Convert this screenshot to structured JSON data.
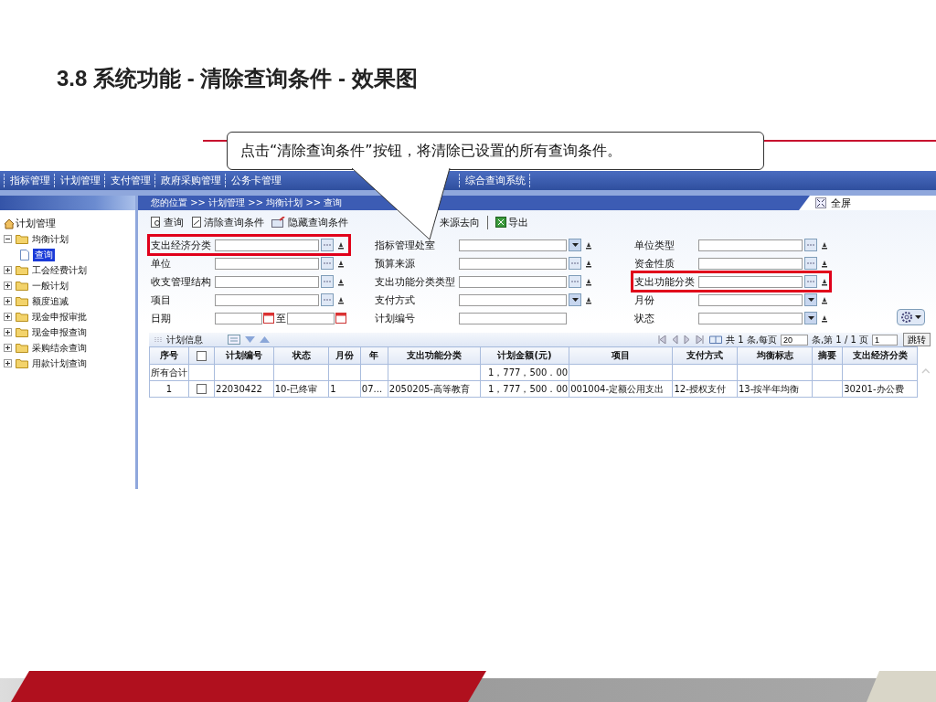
{
  "slide_title": "3.8  系统功能 - 清除查询条件 - 效果图",
  "callout": "点击“清除查询条件”按钮，将清除已设置的所有查询条件。",
  "nav_tabs": [
    {
      "label": "指标管理"
    },
    {
      "label": "计划管理"
    },
    {
      "label": "支付管理"
    },
    {
      "label": "政府采购管理"
    },
    {
      "label": "公务卡管理"
    },
    {
      "label": "综合查询系统"
    }
  ],
  "breadcrumb": "您的位置 >> 计划管理 >> 均衡计划 >> 查询",
  "fullscreen": "全屏",
  "sidebar": {
    "root": "计划管理",
    "items": [
      {
        "label": "均衡计划",
        "expanded": true,
        "children": [
          {
            "label": "查询",
            "selected": true
          }
        ]
      },
      {
        "label": "工会经费计划",
        "expanded": false
      },
      {
        "label": "一般计划",
        "expanded": false
      },
      {
        "label": "额度追减",
        "expanded": false
      },
      {
        "label": "现金申报审批",
        "expanded": false
      },
      {
        "label": "现金申报查询",
        "expanded": false
      },
      {
        "label": "采购结余查询",
        "expanded": false
      },
      {
        "label": "用款计划查询",
        "expanded": false
      }
    ]
  },
  "toolbar": [
    {
      "label": "查询"
    },
    {
      "label": "清除查询条件"
    },
    {
      "label": "隐藏查询条件"
    },
    {
      "label": "来源去向"
    },
    {
      "label": "导出"
    }
  ],
  "form_columns": [
    [
      {
        "label": "支出经济分类",
        "kind": "picker",
        "highlighted": true
      },
      {
        "label": "单位",
        "kind": "picker",
        "highlighted": false
      },
      {
        "label": "收支管理结构",
        "kind": "picker",
        "highlighted": false
      },
      {
        "label": "项目",
        "kind": "picker",
        "highlighted": false
      },
      {
        "label": "日期",
        "kind": "date",
        "separator": "至",
        "highlighted": false
      }
    ],
    [
      {
        "label": "指标管理处室",
        "kind": "select",
        "highlighted": false
      },
      {
        "label": "预算来源",
        "kind": "picker",
        "highlighted": false
      },
      {
        "label": "支出功能分类类型",
        "kind": "picker",
        "highlighted": false
      },
      {
        "label": "支付方式",
        "kind": "select",
        "highlighted": false
      },
      {
        "label": "计划编号",
        "kind": "text",
        "highlighted": false
      }
    ],
    [
      {
        "label": "单位类型",
        "kind": "picker",
        "highlighted": false
      },
      {
        "label": "资金性质",
        "kind": "picker",
        "highlighted": false
      },
      {
        "label": "支出功能分类",
        "kind": "picker",
        "highlighted": true
      },
      {
        "label": "月份",
        "kind": "select",
        "highlighted": false
      },
      {
        "label": "状态",
        "kind": "select",
        "highlighted": false
      }
    ]
  ],
  "grid": {
    "title": "计划信息",
    "pager": {
      "total": "共 1 条,每页",
      "page_size": "20",
      "page_info": "条,第 1 / 1 页",
      "page": "1",
      "jump": "跳转"
    },
    "all_checked": false,
    "columns": [
      "序号",
      "",
      "计划编号",
      "状态",
      "月份",
      "年",
      "支出功能分类",
      "计划金额(元)",
      "项目",
      "支付方式",
      "均衡标志",
      "摘要",
      "支出经济分类"
    ],
    "total_row": {
      "label": "所有合计",
      "amount": "1，777，500．00"
    },
    "rows": [
      {
        "checked": false,
        "cells": [
          "1",
          "",
          "22030422",
          "10-已终审",
          "1",
          "07...",
          "2050205-高等教育",
          "1，777，500．00",
          "001004-定额公用支出",
          "12-授权支付",
          "13-按半年均衡",
          "",
          "30201-办公费"
        ]
      }
    ]
  }
}
